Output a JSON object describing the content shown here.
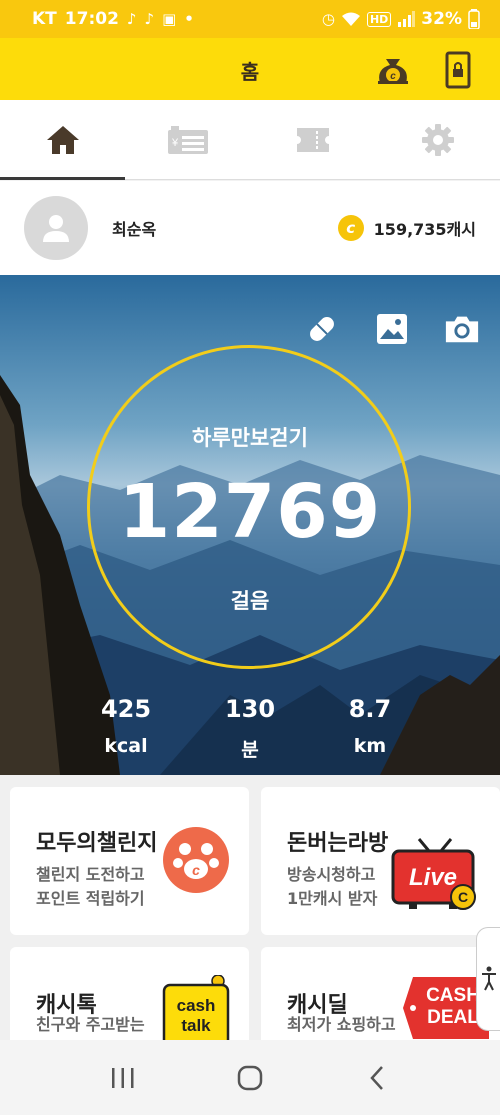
{
  "status_bar": {
    "carrier": "KT",
    "time": "17:02",
    "battery": "32%"
  },
  "header": {
    "title": "홈"
  },
  "tabs": [
    {
      "name": "home",
      "icon": "home-icon"
    },
    {
      "name": "cash-register",
      "icon": "cash-register-icon"
    },
    {
      "name": "ticket",
      "icon": "ticket-icon"
    },
    {
      "name": "settings",
      "icon": "gear-icon"
    }
  ],
  "profile": {
    "name": "최순옥",
    "cash_label": "159,735캐시",
    "coin_symbol": "c"
  },
  "hero": {
    "label": "하루만보걷기",
    "steps": "12769",
    "unit": "걸음",
    "stats": [
      {
        "value": "425",
        "unit": "kcal"
      },
      {
        "value": "130",
        "unit": "분"
      },
      {
        "value": "8.7",
        "unit": "km"
      }
    ]
  },
  "cards": [
    {
      "title": "모두의챌린지",
      "desc1": "챌린지 도전하고",
      "desc2": "포인트 적립하기"
    },
    {
      "title": "돈버는라방",
      "desc1": "방송시청하고",
      "desc2": "1만캐시 받자",
      "badge": "Live"
    },
    {
      "title": "캐시톡",
      "desc1": "친구와 주고받는",
      "badge_line1": "cash",
      "badge_line2": "talk"
    },
    {
      "title": "캐시딜",
      "desc1": "최저가 쇼핑하고",
      "badge_line1": "CASH",
      "badge_line2": "DEAL"
    }
  ],
  "colors": {
    "status_bar": "#f9c80e",
    "header": "#fddc0a",
    "ring": "#f2cd1a",
    "accent_red": "#e3322e"
  }
}
